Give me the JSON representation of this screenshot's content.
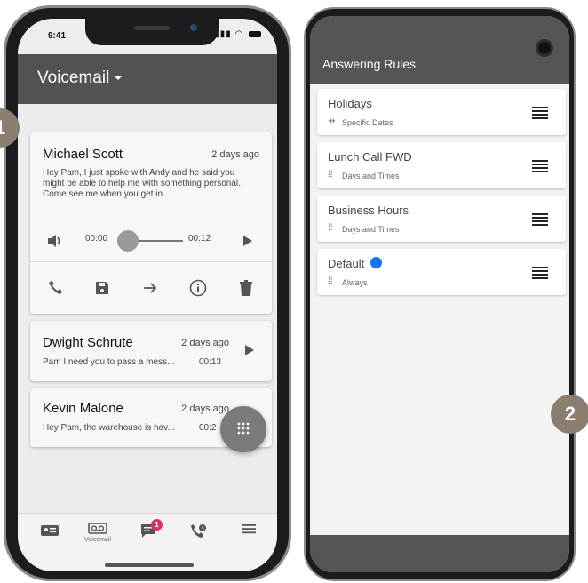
{
  "step_markers": {
    "left": "1",
    "right": "2"
  },
  "iphone": {
    "status_time": "9:41",
    "header": {
      "title": "Voicemail"
    },
    "voicemails": [
      {
        "name": "Michael Scott",
        "when": "2 days ago",
        "message": "Hey Pam, I just spoke with Andy and he said you might be able to help me with something personal.. Come see me when you get in..",
        "elapsed": "00:00",
        "total": "00:12",
        "progress": 0
      },
      {
        "name": "Dwight Schrute",
        "when": "2 days ago",
        "message": "Pam I need you to pass a mess...",
        "duration": "00:13"
      },
      {
        "name": "Kevin Malone",
        "when": "2 days ago",
        "message": "Hey Pam, the warehouse is hav...",
        "duration": "00:2"
      }
    ],
    "actions": [
      "phone-icon",
      "save-icon",
      "forward-arrow-icon",
      "info-icon",
      "trash-icon"
    ],
    "bottom_nav": [
      {
        "icon": "contact-card-icon",
        "label": ""
      },
      {
        "icon": "voicemail-icon",
        "label": "Voicemail"
      },
      {
        "icon": "messages-icon",
        "label": "",
        "badge": "1"
      },
      {
        "icon": "call-history-icon",
        "label": ""
      },
      {
        "icon": "menu-icon",
        "label": ""
      }
    ],
    "fab_icon": "dialpad-icon"
  },
  "android": {
    "header": {
      "title": "Answering Rules"
    },
    "rules": [
      {
        "name": "Holidays",
        "subtitle": "Specific Dates",
        "icon": "calendar-arrow-icon"
      },
      {
        "name": "Lunch Call FWD",
        "subtitle": "Days and Times",
        "icon": "dots-icon"
      },
      {
        "name": "Business Hours",
        "subtitle": "Days and Times",
        "icon": "dots-icon"
      },
      {
        "name": "Default",
        "subtitle": "Always",
        "icon": "dots-icon",
        "active_dot": true
      }
    ],
    "colors": {
      "header": "#555555",
      "active_dot": "#1a73e8",
      "badge": "#d6336c",
      "step_marker": "#8b7d70"
    }
  }
}
